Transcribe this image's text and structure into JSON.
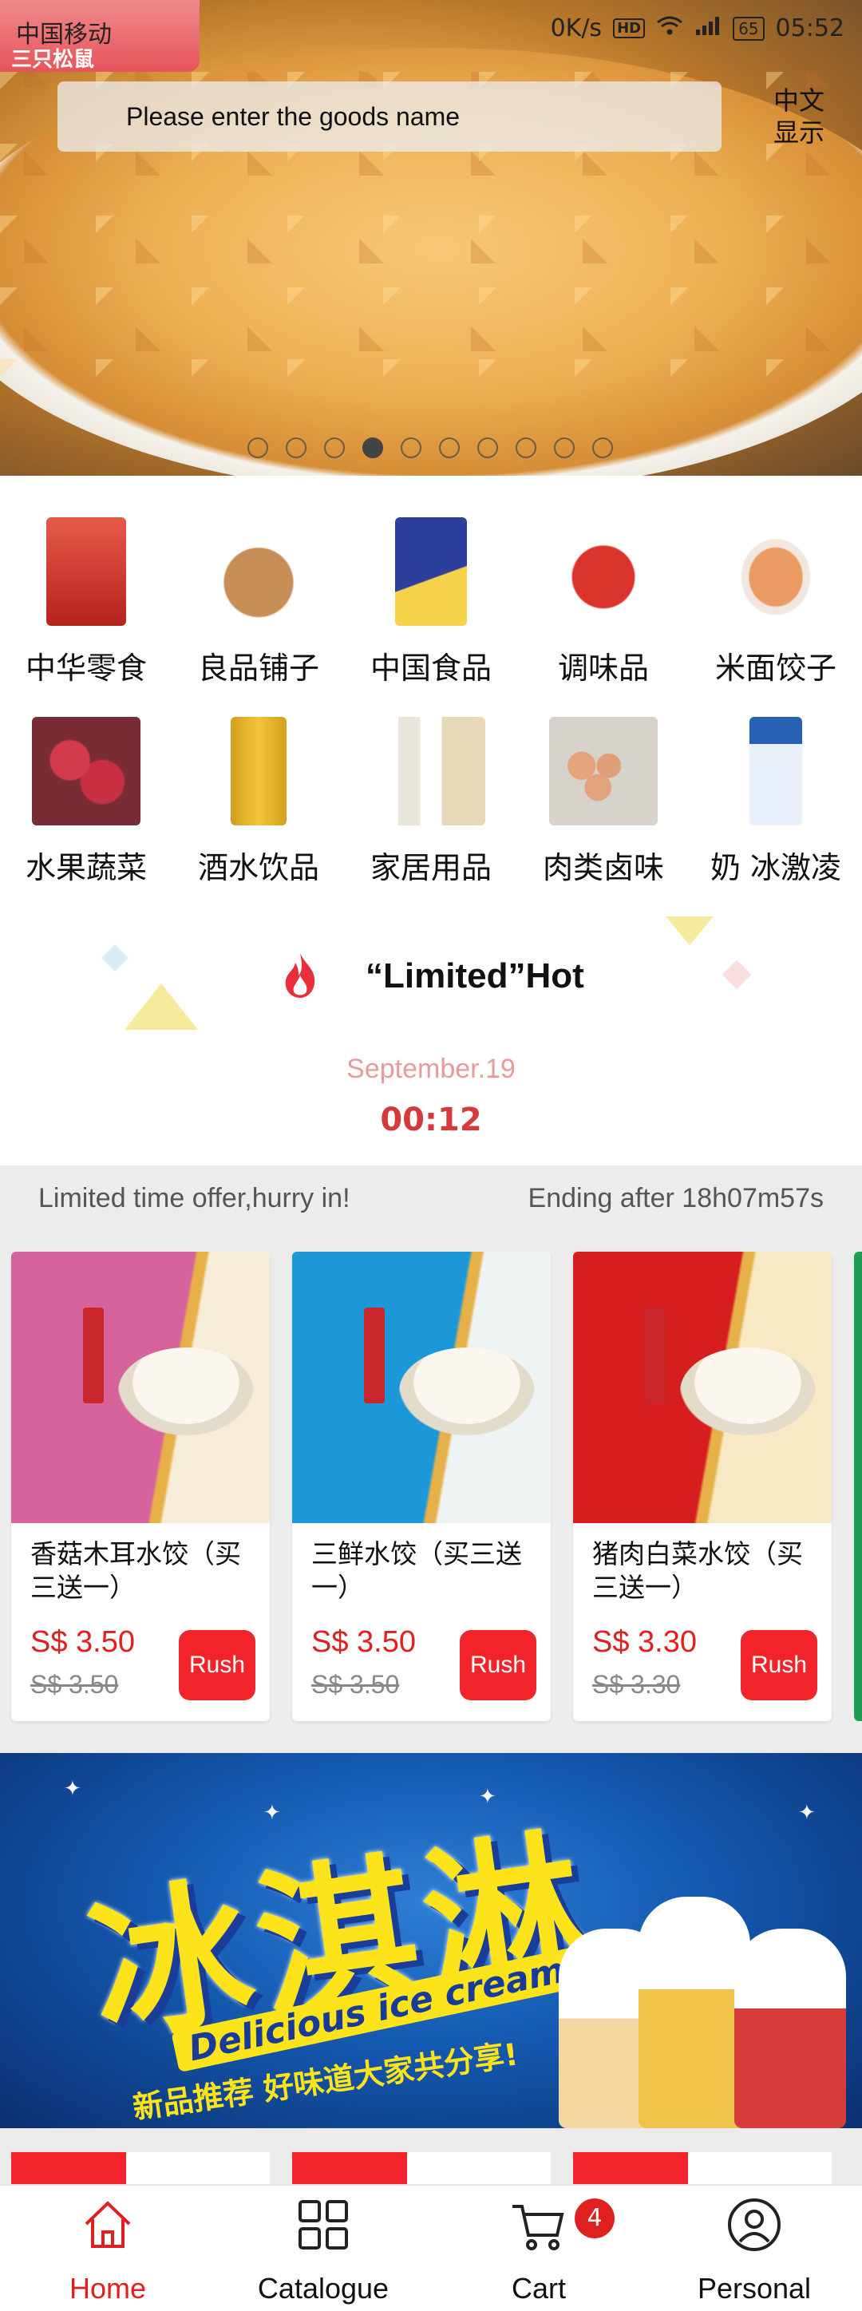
{
  "status_bar": {
    "carrier": "中国移动",
    "speed": "0K/s",
    "hd": "HD",
    "signal": "4G",
    "battery": "65",
    "time": "05:52"
  },
  "header": {
    "search_placeholder": "Please enter the goods name",
    "language_toggle": "中文\n显示",
    "brand_badge": "三只松鼠"
  },
  "banner": {
    "slide_count": 10,
    "active_slide": 4
  },
  "categories": [
    {
      "label": "中华零食",
      "icon": "snack-bag-icon"
    },
    {
      "label": "良品铺子",
      "icon": "nuts-bowl-icon"
    },
    {
      "label": "中国食品",
      "icon": "chips-bag-icon"
    },
    {
      "label": "调味品",
      "icon": "sauce-jar-icon"
    },
    {
      "label": "米面饺子",
      "icon": "noodle-bowl-icon"
    },
    {
      "label": "水果蔬菜",
      "icon": "lychee-icon"
    },
    {
      "label": "酒水饮品",
      "icon": "drink-can-icon"
    },
    {
      "label": "家居用品",
      "icon": "shampoo-icon"
    },
    {
      "label": "肉类卤味",
      "icon": "eggs-icon"
    },
    {
      "label": "奶 冰激凌",
      "icon": "milk-carton-icon"
    }
  ],
  "limited_hot": {
    "title": "“Limited”Hot",
    "date": "September.19",
    "time": "00:12"
  },
  "offer": {
    "left_text": "Limited time offer,hurry in!",
    "right_text": "Ending after 18h07m57s"
  },
  "products": [
    {
      "name": "香菇木耳水饺（买三送一）",
      "price": "S$ 3.50",
      "old_price": "S$ 3.50",
      "button": "Rush",
      "accent": "#d7639c"
    },
    {
      "name": "三鲜水饺（买三送一）",
      "price": "S$ 3.50",
      "old_price": "S$ 3.50",
      "button": "Rush",
      "accent": "#1c98d8"
    },
    {
      "name": "猪肉白菜水饺（买三送一）",
      "price": "S$ 3.30",
      "old_price": "S$ 3.30",
      "button": "Rush",
      "accent": "#d61e1e"
    }
  ],
  "ice_banner": {
    "headline": "冰淇淋",
    "english": "Delicious ice cream",
    "slogan": "新品推荐 好味道大家共分享!"
  },
  "bottom_nav": [
    {
      "label": "Home",
      "icon": "home-icon",
      "active": true
    },
    {
      "label": "Catalogue",
      "icon": "grid-icon",
      "active": false
    },
    {
      "label": "Cart",
      "icon": "cart-icon",
      "active": false
    },
    {
      "label": "Personal",
      "icon": "user-icon",
      "active": false
    }
  ],
  "cart_badge": "4",
  "colors": {
    "accent_red": "#e0201f",
    "rush_red": "#f2232a",
    "date_pink": "#e59c9c"
  }
}
